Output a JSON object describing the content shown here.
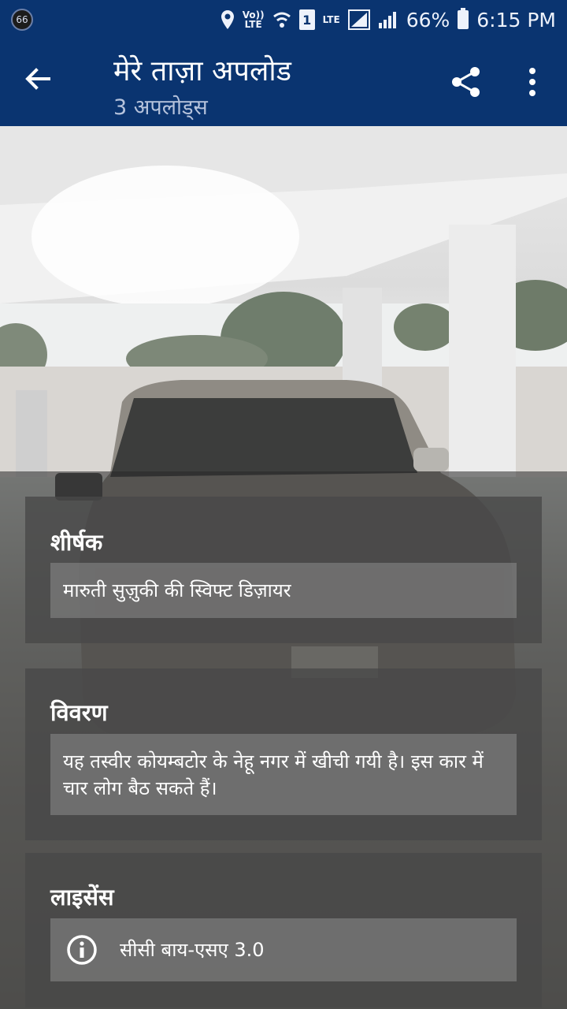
{
  "status_bar": {
    "notification_badge": "66",
    "volte_label": "Vo)) LTE",
    "sim_slot": "1",
    "network_label": "LTE",
    "battery": "66%",
    "time": "6:15 PM"
  },
  "app_bar": {
    "title": "मेरे ताज़ा अपलोड",
    "subtitle": "3 अपलोड्स",
    "back_icon": "arrow-left-icon",
    "share_icon": "share-icon",
    "more_icon": "more-vert-icon",
    "color": "#0a3470"
  },
  "details": {
    "title_section": {
      "label": "शीर्षक",
      "value": "मारुती सुज़ुकी की स्विफ्ट डिज़ायर"
    },
    "description_section": {
      "label": "विवरण",
      "value": "यह तस्वीर कोयम्बटोर के नेहू नगर में खीची गयी है। इस कार में चार लोग बैठ सकते हैं।"
    },
    "license_section": {
      "label": "लाइसेंस",
      "value": "सीसी बाय-एसए 3.0",
      "icon": "info-icon"
    }
  }
}
